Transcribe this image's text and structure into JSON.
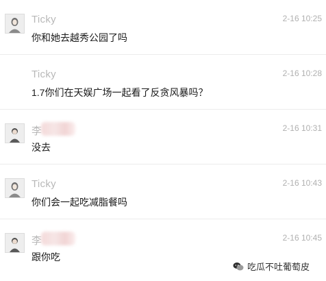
{
  "messages": [
    {
      "name": "Ticky",
      "time": "2-16 10:25",
      "text": "你和她去越秀公园了吗",
      "avatar": "female-avatar-icon"
    },
    {
      "name": "Ticky",
      "time": "2-16 10:28",
      "text": "1.7你们在天娱广场一起看了反贪风暴吗？",
      "avatar": "none"
    },
    {
      "name": "李",
      "time": "2-16 10:31",
      "text": "没去",
      "avatar": "male-avatar-icon"
    },
    {
      "name": "Ticky",
      "time": "2-16 10:43",
      "text": "你们会一起吃减脂餐吗",
      "avatar": "female-avatar-icon"
    },
    {
      "name": "李",
      "time": "2-16 10:45",
      "text": "跟你吃",
      "avatar": "male-avatar-icon"
    }
  ],
  "watermark": {
    "text": "吃瓜不吐葡萄皮",
    "icon": "wechat-icon"
  },
  "colors": {
    "name": "#b8b8b8",
    "time": "#b0b0b0",
    "text": "#1a1a1a",
    "divider": "#ececec"
  }
}
